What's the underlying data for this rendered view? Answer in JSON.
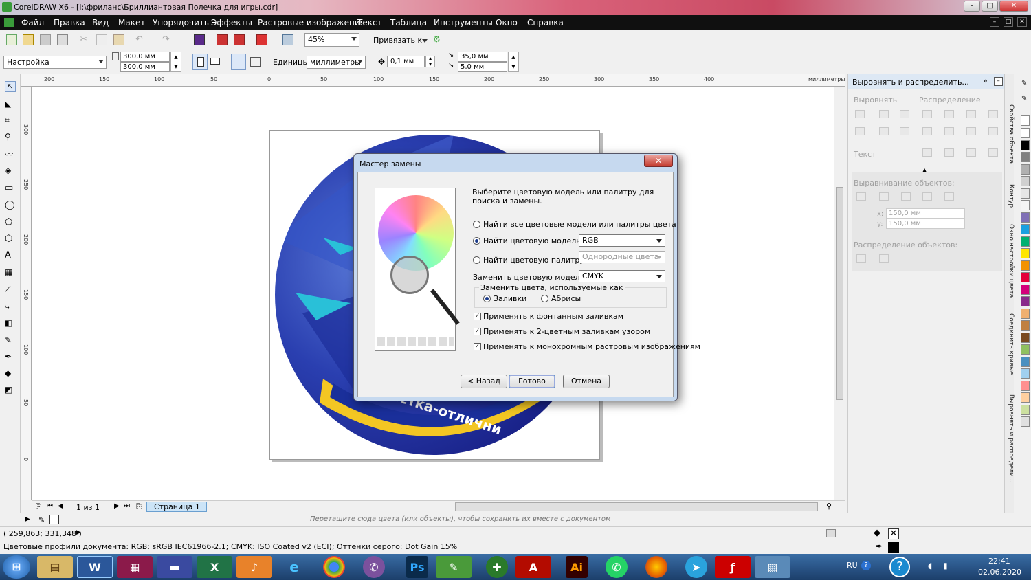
{
  "window": {
    "title": "CorelDRAW X6 - [I:\\фриланс\\Бриллиантовая Полечка для игры.cdr]"
  },
  "menu": [
    "Файл",
    "Правка",
    "Вид",
    "Макет",
    "Упорядочить",
    "Эффекты",
    "Растровые изображения",
    "Текст",
    "Таблица",
    "Инструменты",
    "Окно",
    "Справка"
  ],
  "toolbar": {
    "zoom": "45%",
    "snap_label": "Привязать к"
  },
  "propbar": {
    "preset": "Настройка",
    "width": "300,0 мм",
    "height": "300,0 мм",
    "units_label": "Единицы:",
    "units_value": "миллиметры",
    "nudge": "0,1 мм",
    "dup_x": "35,0 мм",
    "dup_y": "5,0 мм"
  },
  "ruler": {
    "unit_label": "миллиметры",
    "h_ticks": [
      "200",
      "150",
      "100",
      "50",
      "0",
      "50",
      "100",
      "150",
      "200",
      "250",
      "300",
      "350",
      "400"
    ],
    "v_ticks": [
      "300",
      "250",
      "200",
      "150",
      "100",
      "50",
      "0"
    ]
  },
  "artwork": {
    "badge_text": "Гимнастка-отлични"
  },
  "dialog": {
    "title": "Мастер замены",
    "intro": "Выберите цветовую модель или палитру для поиска и замены.",
    "opt_all": "Найти все цветовые модели или палитры цвета",
    "opt_model": "Найти цветовую модель:",
    "model_value": "RGB",
    "opt_palette": "Найти цветовую палитру:",
    "palette_value": "Однородные цвета",
    "replace_label": "Заменить цветовую модель:",
    "replace_value": "CMYK",
    "group_label": "Заменить цвета, используемые как",
    "fills": "Заливки",
    "outlines": "Абрисы",
    "chk1": "Применять к фонтанным заливкам",
    "chk2": "Применять к 2-цветным заливкам узором",
    "chk3": "Применять к монохромным растровым изображениям",
    "back": "< Назад",
    "done": "Готово",
    "cancel": "Отмена"
  },
  "docker": {
    "title": "Выровнять и распределить...",
    "align": "Выровнять",
    "distribute": "Распределение",
    "text": "Текст",
    "align_objects": "Выравнивание объектов:",
    "x": "150,0 мм",
    "y": "150,0 мм",
    "x_lbl": "x:",
    "y_lbl": "y:",
    "dist_objects": "Распределение объектов:",
    "tabs": [
      "Свойства объекта",
      "Контур",
      "Окно настройки цвета",
      "Соединить кривые",
      "Выровнять и распредели..."
    ]
  },
  "pager": {
    "count": "1 из 1",
    "page": "Страница 1"
  },
  "status": {
    "hint": "Перетащите сюда цвета (или объекты), чтобы сохранить их вместе с документом",
    "coords": "( 259,863; 331,348 )",
    "profiles": "Цветовые профили документа: RGB: sRGB IEC61966-2.1; CMYK: ISO Coated v2 (ECI); Оттенки серого: Dot Gain 15%"
  },
  "taskbar": {
    "lang": "RU",
    "time": "22:41",
    "date": "02.06.2020"
  },
  "palette": [
    "#ffffff",
    "#000000",
    "#808080",
    "#b0b0b0",
    "#d0d0d0",
    "#e6e6e6",
    "#f4f4f4",
    "#7f6fb5",
    "#1aa0e0",
    "#00b070",
    "#ffe600",
    "#f39200",
    "#e4003a",
    "#d4007a",
    "#8a2a8a",
    "#f0b070",
    "#c08040",
    "#7a4a20",
    "#90c060",
    "#4a90c0",
    "#a0d0f0",
    "#ff9090",
    "#ffd0a0",
    "#cce0a0",
    "#e0e0e0"
  ],
  "colors": {
    "accent": "#c94a63",
    "menubar": "#101010",
    "artwork": "#2a3fb0"
  }
}
